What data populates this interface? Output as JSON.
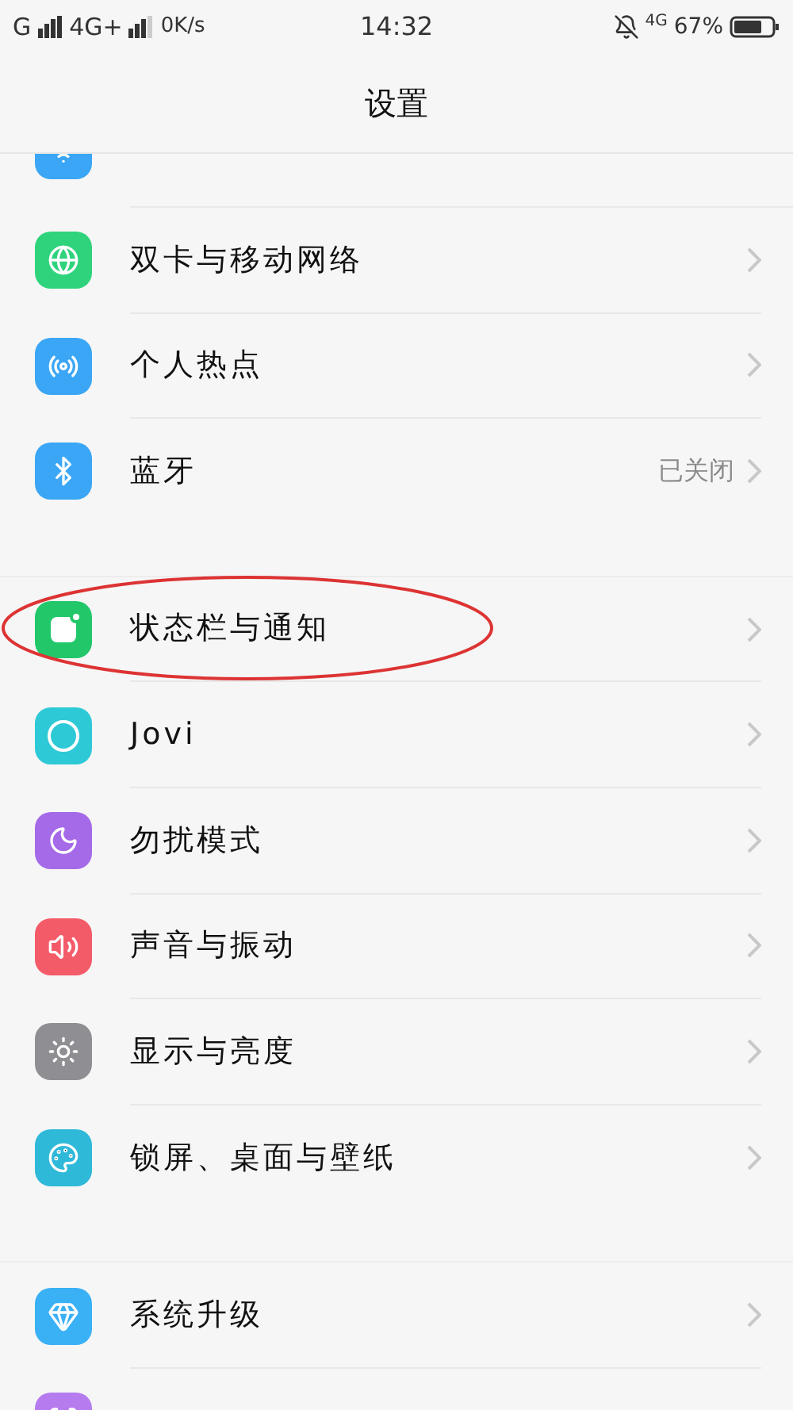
{
  "status_bar": {
    "carrier_1": "G",
    "carrier_2": "4G+",
    "speed": "0K/s",
    "time": "14:32",
    "network": "4G",
    "battery": "67%"
  },
  "header": {
    "title": "设置"
  },
  "sections": [
    {
      "items": [
        {
          "color": "#3aa6f5"
        },
        {
          "label": "双卡与移动网络",
          "color": "#2fd37c"
        },
        {
          "label": "个人热点",
          "color": "#3aa6f5"
        },
        {
          "label": "蓝牙",
          "value": "已关闭",
          "color": "#3aa6f5"
        }
      ]
    },
    {
      "items": [
        {
          "label": "状态栏与通知",
          "color": "#22c76a",
          "circled": true
        },
        {
          "label": "Jovi",
          "color": "#2ec9d6",
          "circled": false
        },
        {
          "label": "勿扰模式",
          "color": "#a56ae8",
          "circled": false
        },
        {
          "label": "声音与振动",
          "color": "#f45b69",
          "circled": false
        },
        {
          "label": "显示与亮度",
          "color": "#8e8e93",
          "circled": false
        },
        {
          "label": "锁屏、桌面与壁纸",
          "color": "#2fb9d9",
          "circled": false
        }
      ]
    },
    {
      "items": [
        {
          "label": "系统升级",
          "color": "#3ab0f5"
        },
        {
          "color": "#b57bef"
        }
      ]
    }
  ]
}
